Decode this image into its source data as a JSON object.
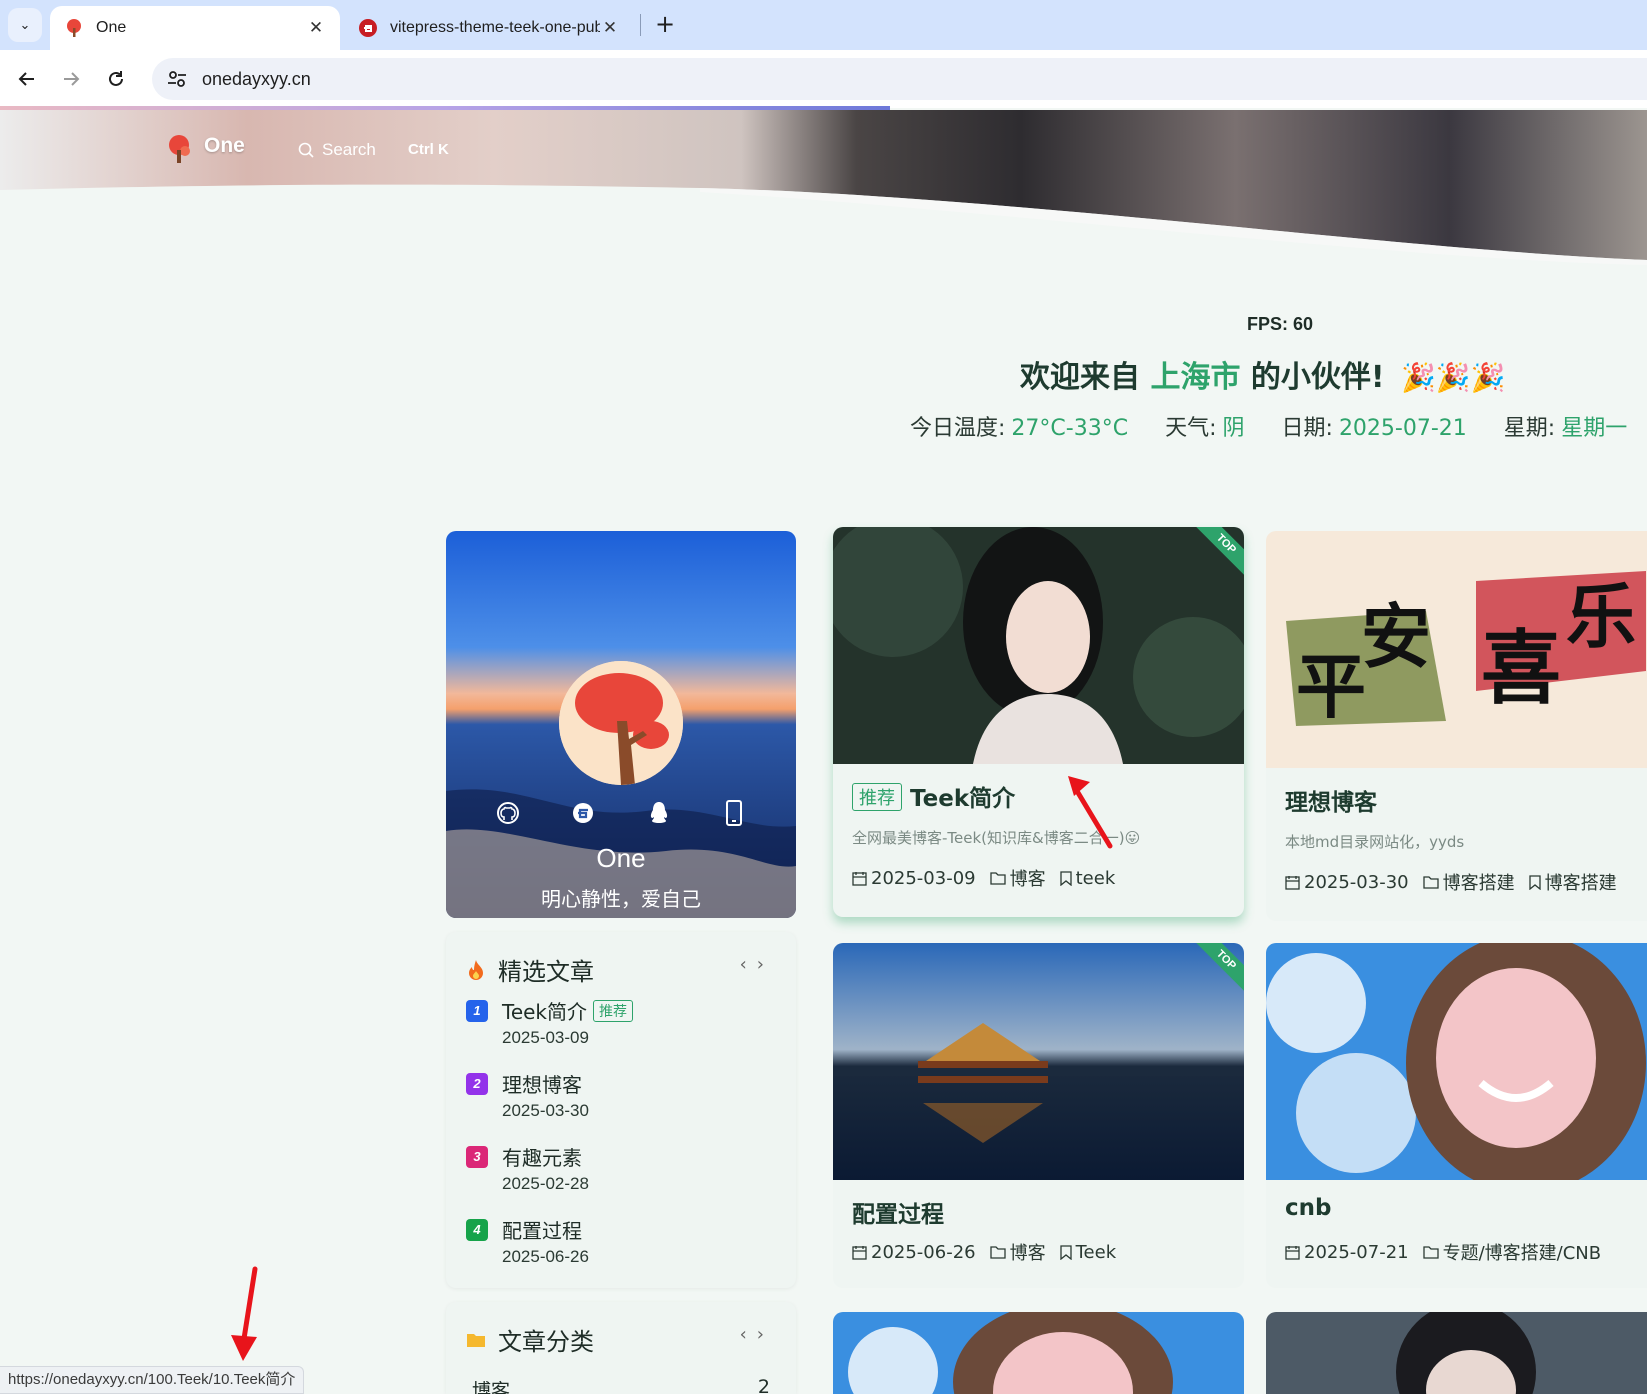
{
  "browser": {
    "tabs": [
      {
        "title": "One",
        "active": true
      },
      {
        "title": "vitepress-theme-teek-one-public",
        "active": false
      }
    ],
    "new_tab_label": "+",
    "close_label": "✕",
    "address": "onedayxyy.cn",
    "status_url": "https://onedayxyy.cn/100.Teek/10.Teek简介"
  },
  "site": {
    "logo_text": "One",
    "search_label": "Search",
    "search_shortcut": "Ctrl K"
  },
  "welcome": {
    "fps": "FPS: 60",
    "greeting_prefix": "欢迎来自",
    "city": "上海市",
    "greeting_suffix": "的小伙伴!",
    "emoji": "🎉🎉🎉",
    "temp_label": "今日温度:",
    "temp_value": "27°C-33°C",
    "weather_label": "天气:",
    "weather_value": "阴",
    "date_label": "日期:",
    "date_value": "2025-07-21",
    "weekday_label": "星期:",
    "weekday_value": "星期一"
  },
  "profile": {
    "name": "One",
    "motto": "明心静性，爱自己",
    "socials": [
      "github-icon",
      "gitee-icon",
      "qq-icon",
      "phone-icon"
    ]
  },
  "featured": {
    "title": "精选文章",
    "items": [
      {
        "num": "1",
        "title": "Teek简介",
        "tag": "推荐",
        "date": "2025-03-09",
        "color": "#2563eb"
      },
      {
        "num": "2",
        "title": "理想博客",
        "tag": "",
        "date": "2025-03-30",
        "color": "#9333ea"
      },
      {
        "num": "3",
        "title": "有趣元素",
        "tag": "",
        "date": "2025-02-28",
        "color": "#db2777"
      },
      {
        "num": "4",
        "title": "配置过程",
        "tag": "",
        "date": "2025-06-26",
        "color": "#16a34a"
      }
    ]
  },
  "categories": {
    "title": "文章分类",
    "items": [
      {
        "name": "博客",
        "count": "2"
      }
    ]
  },
  "posts": [
    {
      "title": "Teek简介",
      "tag": "推荐",
      "top": "TOP",
      "desc": "全网最美博客-Teek(知识库&博客二合一)😛",
      "date": "2025-03-09",
      "category": "博客",
      "label": "teek"
    },
    {
      "title": "理想博客",
      "top": "",
      "desc": "本地md目录网站化，yyds",
      "date": "2025-03-30",
      "category": "博客搭建",
      "label": "博客搭建"
    },
    {
      "title": "配置过程",
      "top": "TOP",
      "desc": "",
      "date": "2025-06-26",
      "category": "博客",
      "label": "Teek"
    },
    {
      "title": "cnb",
      "top": "",
      "desc": "",
      "date": "2025-07-21",
      "category": "专题/博客搭建/CNB",
      "label": ""
    }
  ],
  "colors": {
    "accent": "#2ea36b",
    "arrow": "#e8141b"
  }
}
